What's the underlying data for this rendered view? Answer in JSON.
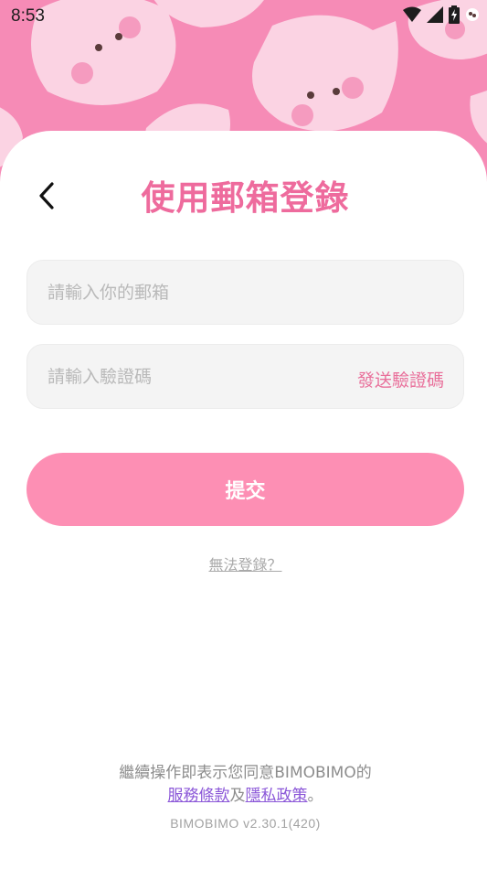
{
  "status_bar": {
    "time": "8:53",
    "icons": [
      "wifi-icon",
      "signal-icon",
      "battery-charging-icon",
      "notification-dot-icon"
    ]
  },
  "header": {
    "title": "使用郵箱登錄",
    "back_icon": "chevron-left-icon"
  },
  "form": {
    "email_placeholder": "請輸入你的郵箱",
    "code_placeholder": "請輸入驗證碼",
    "send_code_label": "發送驗證碼",
    "submit_label": "提交"
  },
  "help": {
    "cant_login_label": "無法登錄？"
  },
  "footer": {
    "agreement_text": "繼續操作即表示您同意BIMOBIMO的",
    "terms_label": "服務條款",
    "and_text": "及",
    "privacy_label": "隱私政策",
    "period": "。",
    "version": "BIMOBIMO v2.30.1(420)"
  },
  "colors": {
    "background_pink": "#f68bb6",
    "title_pink": "#ee6b9d",
    "button_pink": "#fd8fb4",
    "link_purple": "#8b57d8"
  }
}
